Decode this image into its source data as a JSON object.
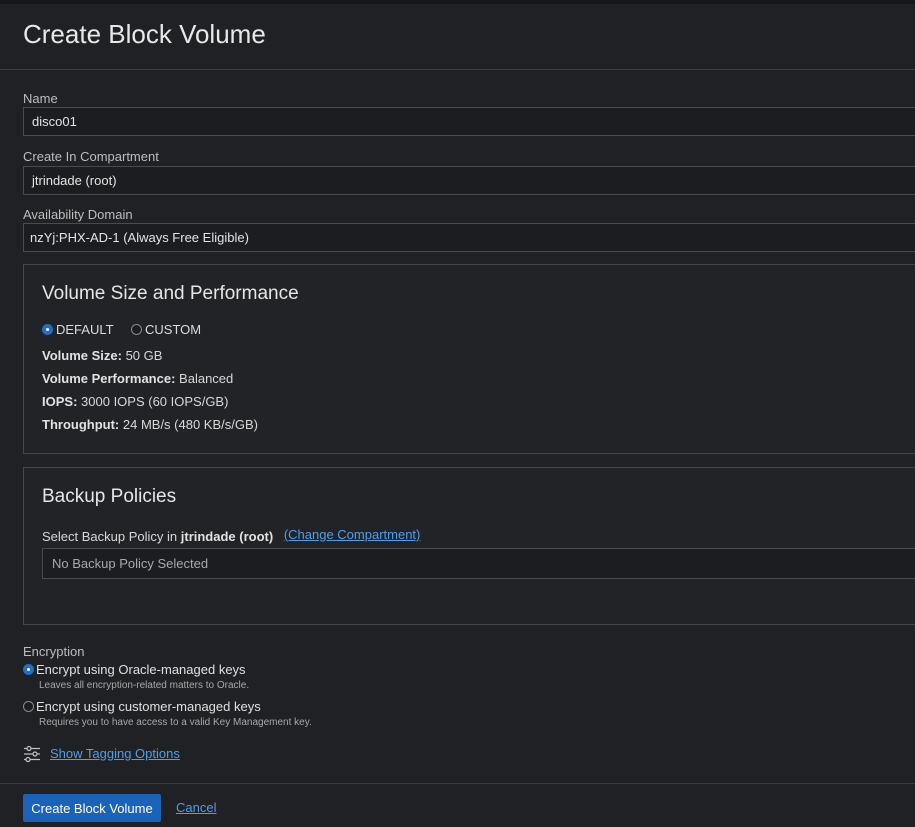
{
  "page": {
    "title": "Create Block Volume"
  },
  "fields": {
    "name": {
      "label": "Name",
      "value": "disco01"
    },
    "compartment": {
      "label": "Create In Compartment",
      "value": "jtrindade (root)"
    },
    "availability_domain": {
      "label": "Availability Domain",
      "value": "nzYj:PHX-AD-1 (Always Free Eligible)"
    }
  },
  "volume": {
    "title": "Volume Size and Performance",
    "options": [
      {
        "label": "DEFAULT",
        "selected": true
      },
      {
        "label": "CUSTOM",
        "selected": false
      }
    ],
    "size": {
      "label": "Volume Size:",
      "value": "50 GB"
    },
    "performance": {
      "label": "Volume Performance:",
      "value": "Balanced"
    },
    "iops": {
      "label": "IOPS:",
      "value": "3000 IOPS (60 IOPS/GB)"
    },
    "throughput": {
      "label": "Throughput:",
      "value": "24 MB/s (480 KB/s/GB)"
    }
  },
  "backup": {
    "title": "Backup Policies",
    "select_prefix": "Select Backup Policy in",
    "compartment": "jtrindade (root)",
    "change_link": "(Change Compartment)",
    "placeholder": "No Backup Policy Selected"
  },
  "encryption": {
    "title": "Encryption",
    "options": [
      {
        "label": "Encrypt using Oracle-managed keys",
        "description": "Leaves all encryption-related matters to Oracle.",
        "selected": true
      },
      {
        "label": "Encrypt using customer-managed keys",
        "description": "Requires you to have access to a valid Key Management key.",
        "selected": false
      }
    ]
  },
  "tagging": {
    "label": "Show Tagging Options"
  },
  "footer": {
    "submit_label": "Create Block Volume",
    "cancel_label": "Cancel"
  },
  "colors": {
    "accent": "#1a63b8",
    "link": "#4f9fea",
    "background": "#202124"
  }
}
